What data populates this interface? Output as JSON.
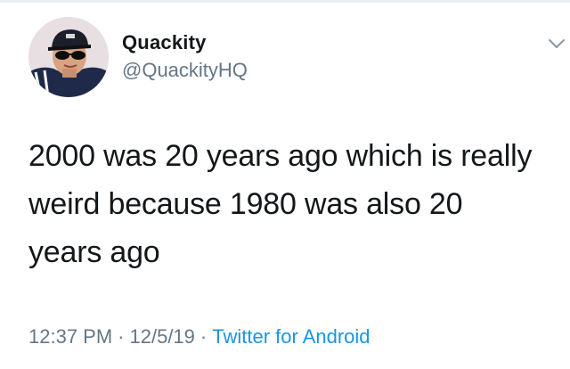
{
  "tweet": {
    "author": {
      "display_name": "Quackity",
      "handle": "@QuackityHQ",
      "avatar_icon": "profile-photo"
    },
    "caret_icon": "chevron-down-icon",
    "text_lines": [
      "2000 was 20 years ago which is really",
      "weird because 1980 was also 20",
      "years ago"
    ],
    "meta": {
      "time": "12:37 PM",
      "separator": "·",
      "date": "12/5/19",
      "source": "Twitter for Android"
    }
  },
  "colors": {
    "text": "#14171a",
    "secondary": "#657786",
    "link": "#1b95e0",
    "background": "#ffffff"
  }
}
